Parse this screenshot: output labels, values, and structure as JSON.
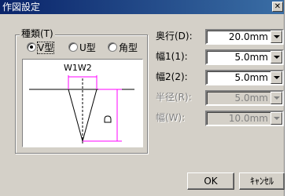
{
  "window": {
    "title": "作図設定",
    "close_glyph": "✕"
  },
  "type_group": {
    "label": "種類(T)",
    "options": [
      {
        "label": "V型",
        "selected": true
      },
      {
        "label": "U型",
        "selected": false
      },
      {
        "label": "角型",
        "selected": false
      }
    ]
  },
  "diagram": {
    "label": "W1W2"
  },
  "fields": [
    {
      "label": "奥行(D):",
      "value": "20.0mm",
      "enabled": true
    },
    {
      "label": "幅1(1):",
      "value": "5.0mm",
      "enabled": true
    },
    {
      "label": "幅2(2):",
      "value": "5.0mm",
      "enabled": true
    },
    {
      "label": "半径(R):",
      "value": "5.0mm",
      "enabled": false
    },
    {
      "label": "幅(W):",
      "value": "10.0mm",
      "enabled": false
    }
  ],
  "buttons": {
    "ok": "OK",
    "cancel": "ｷｬﾝｾﾙ"
  },
  "colors": {
    "titlebar": "#0a246a",
    "dimension_lines": "#ff00ff",
    "face": "#d4d0c8"
  }
}
